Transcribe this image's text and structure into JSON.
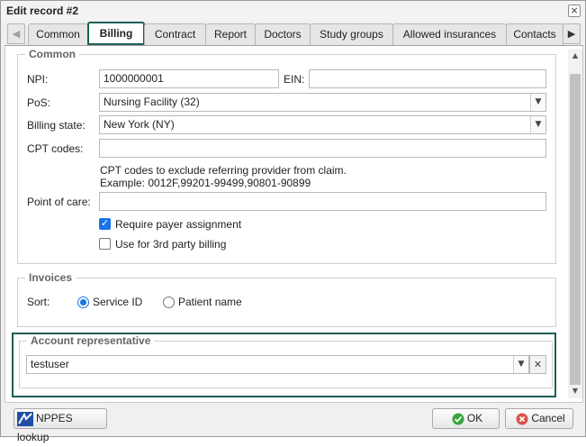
{
  "window": {
    "title": "Edit record #2",
    "close_icon": "×"
  },
  "tabs": [
    "Common",
    "Billing",
    "Contract",
    "Report",
    "Doctors",
    "Study groups",
    "Allowed insurances",
    "Contacts"
  ],
  "active_tab": "Billing",
  "common": {
    "legend": "Common",
    "npi_label": "NPI:",
    "npi_value": "1000000001",
    "ein_label": "EIN:",
    "ein_value": "",
    "pos_label": "PoS:",
    "pos_value": "Nursing Facility (32)",
    "billing_state_label": "Billing state:",
    "billing_state_value": "New York (NY)",
    "cpt_label": "CPT codes:",
    "cpt_value": "",
    "cpt_hint_line1": "CPT codes to exclude referring provider from claim.",
    "cpt_hint_line2": "Example: 0012F,99201-99499,90801-90899",
    "poc_label": "Point of care:",
    "poc_value": "",
    "require_payer_label": "Require payer assignment",
    "require_payer_checked": true,
    "third_party_label": "Use for 3rd party billing",
    "third_party_checked": false
  },
  "invoices": {
    "legend": "Invoices",
    "sort_label": "Sort:",
    "options": [
      "Service ID",
      "Patient name"
    ],
    "selected": "Service ID"
  },
  "account_rep": {
    "legend": "Account representative",
    "value": "testuser"
  },
  "footer": {
    "nppes_label": "NPPES lookup",
    "ok_label": "OK",
    "cancel_label": "Cancel"
  },
  "colors": {
    "highlight": "#1a5e55",
    "checkbox_accent": "#1a73e8",
    "ok_icon": "#3aa53a",
    "cancel_icon": "#d9534f"
  },
  "icons": {
    "tab_scroll_left": "left-arrow-icon",
    "tab_scroll_right": "right-arrow-icon",
    "combo_dropdown": "chevron-down-icon",
    "clear": "close-icon",
    "nppes": "nppes-logo-icon",
    "ok": "check-circle-icon",
    "cancel": "cancel-circle-icon"
  }
}
